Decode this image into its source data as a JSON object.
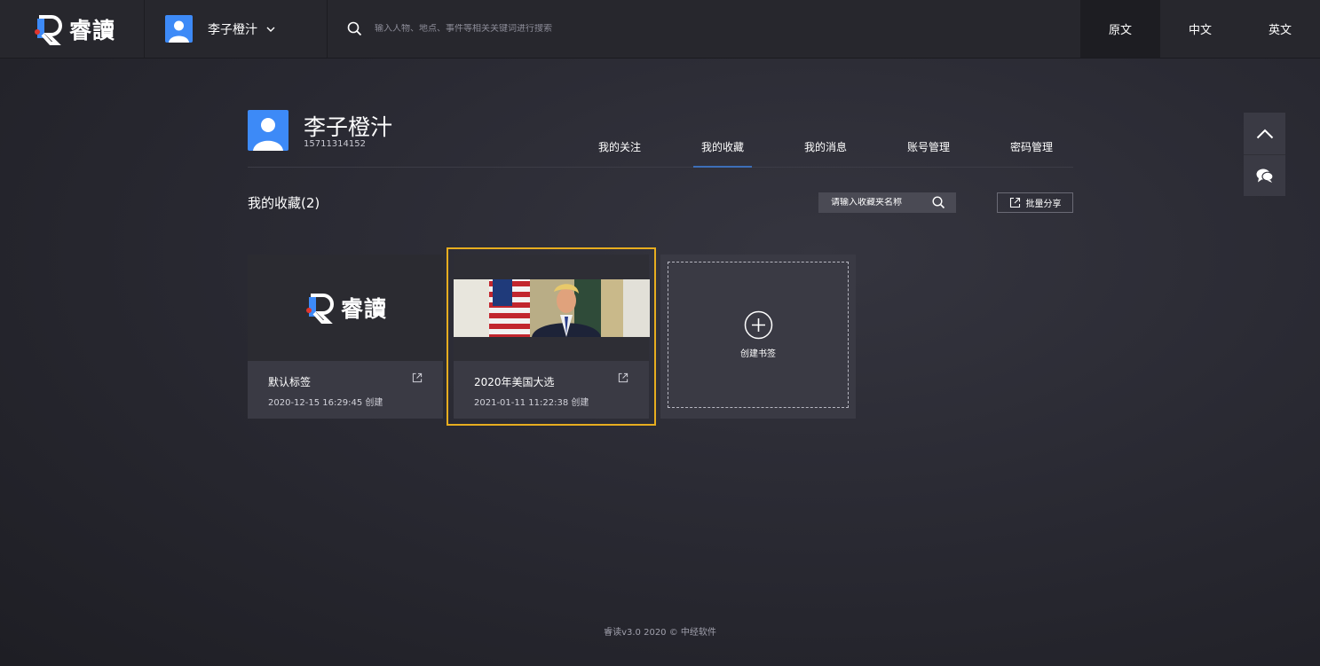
{
  "header": {
    "logo_text": "睿讀",
    "user_name": "李子橙汁",
    "search_placeholder": "输入人物、地点、事件等相关关键词进行搜索",
    "languages": [
      "原文",
      "中文",
      "英文"
    ],
    "active_language": "原文"
  },
  "profile": {
    "name": "李子橙汁",
    "phone": "15711314152",
    "tabs": [
      "我的关注",
      "我的收藏",
      "我的消息",
      "账号管理",
      "密码管理"
    ],
    "active_tab": "我的收藏"
  },
  "favorites": {
    "title": "我的收藏(2)",
    "search_placeholder": "请输入收藏夹名称",
    "share_label": "批量分享",
    "cards": [
      {
        "title": "默认标签",
        "date": "2020-12-15 16:29:45 创建",
        "thumb": "logo"
      },
      {
        "title": "2020年美国大选",
        "date": "2021-01-11 11:22:38 创建",
        "thumb": "photo"
      }
    ],
    "new_card_label": "创建书签"
  },
  "footer": "睿读v3.0 2020 © 中经软件",
  "colors": {
    "accent_blue": "#3d8af7",
    "selection_outline": "#e7ad1f",
    "logo_red": "#e0362e"
  }
}
